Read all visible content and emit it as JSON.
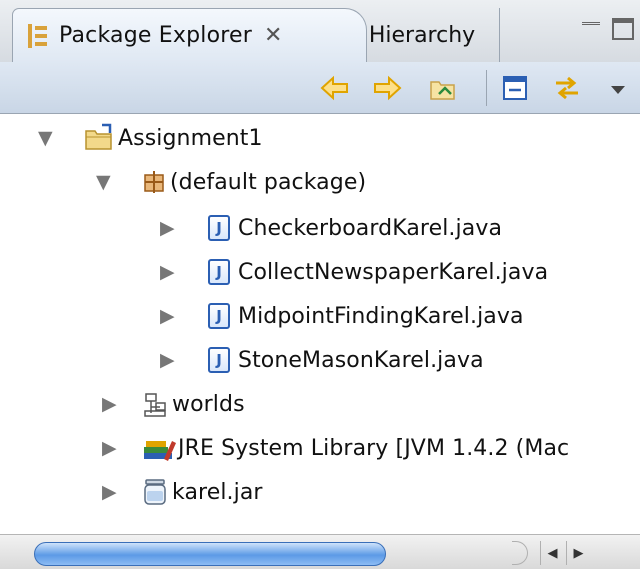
{
  "tabs": {
    "active_label": "Package Explorer",
    "inactive_label": "Hierarchy"
  },
  "toolbar": {
    "icons": [
      "back-arrow-icon",
      "forward-arrow-icon",
      "up-folder-icon",
      "collapse-all-icon",
      "link-with-editor-icon",
      "view-menu-icon"
    ]
  },
  "tree": {
    "project": "Assignment1",
    "package": "(default package)",
    "files": [
      "CheckerboardKarel.java",
      "CollectNewspaperKarel.java",
      "MidpointFindingKarel.java",
      "StoneMasonKarel.java"
    ],
    "worlds": "worlds",
    "jre": "JRE System Library [JVM 1.4.2 (Mac",
    "jar": "karel.jar"
  },
  "colors": {
    "accent_blue": "#2b5fb3",
    "arrow_yellow": "#f0b400",
    "scroll_thumb": "#5c9ae6"
  }
}
